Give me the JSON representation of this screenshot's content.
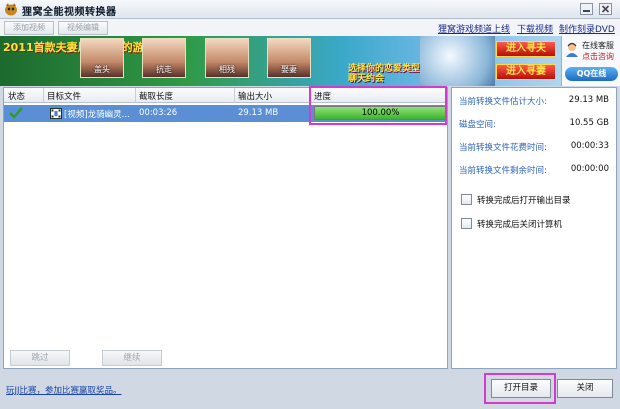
{
  "window": {
    "title": "狸窝全能视频转换器"
  },
  "toolbar": {
    "add_label": "添加视频",
    "delete_label": "视频编辑",
    "links": [
      "狸窝游戏频道上线",
      "下载视频",
      "制作刻录DVD"
    ]
  },
  "banner": {
    "title": "2011首款夫妻风花雪月的游戏",
    "captions": [
      "盖头",
      "抗走",
      "相残",
      "娶妻"
    ],
    "game_text": "选择你的恋爱类型 聊天约会",
    "btn_enter": "进入寻夫",
    "btn_enter2": "进入寻妻",
    "service_t1": "在线客服",
    "service_t2": "点击咨询",
    "service_qq": "QQ在线"
  },
  "table": {
    "columns": [
      "状态",
      "目标文件",
      "截取长度",
      "输出大小",
      "进度"
    ],
    "rows": [
      {
        "status_icon": "check-icon",
        "file": "[视频]龙骑幽灵...",
        "duration": "00:03:26",
        "size": "29.13 MB",
        "progress_text": "100.00%",
        "progress": 1.0
      }
    ]
  },
  "list_footer": {
    "skip_label": "跳过",
    "continue_label": "继续"
  },
  "info": {
    "lines": [
      {
        "label": "当前转换文件估计大小:",
        "value": "29.13 MB"
      },
      {
        "label": "磁盘空间:",
        "value": "10.55 GB"
      },
      {
        "label": "当前转换文件花费时间:",
        "value": "00:00:33"
      },
      {
        "label": "当前转换文件剩余时间:",
        "value": "00:00:00"
      }
    ],
    "opt_open_dir": "转换完成后打开输出目录",
    "opt_shutdown": "转换完成后关闭计算机"
  },
  "bottom": {
    "link": "玩JJ比赛，参加比赛赢取奖品。",
    "open_dir_label": "打开目录",
    "close_label": "关闭"
  }
}
